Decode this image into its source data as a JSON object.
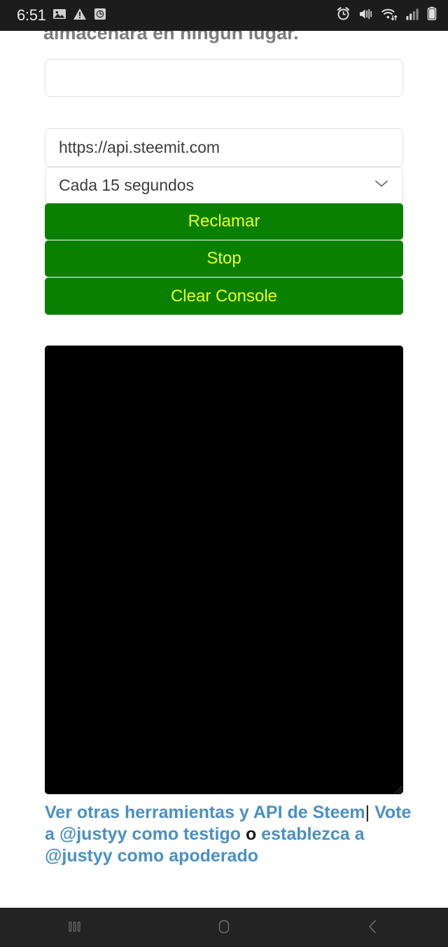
{
  "status_bar": {
    "time": "6:51",
    "left_icons": [
      {
        "name": "image-icon"
      },
      {
        "name": "warning-triangle-icon"
      },
      {
        "name": "timer-icon"
      }
    ],
    "right_icons": [
      {
        "name": "alarm-clock-icon"
      },
      {
        "name": "volume-mute-vibrate-icon"
      },
      {
        "name": "wifi-data-transfer-icon"
      },
      {
        "name": "cellular-signal-icon"
      },
      {
        "name": "battery-icon"
      }
    ],
    "background_color": "#1c1c1c",
    "foreground_color": "#e8e8e8"
  },
  "page": {
    "intro_text": "almacenará en ningún lugar.",
    "key_input": {
      "value": "",
      "placeholder": ""
    },
    "api_input": {
      "value": "https://api.steemit.com",
      "placeholder": "https://api.steemit.com"
    },
    "interval_select": {
      "selected": "Cada 15 segundos",
      "icon": "chevron-down-icon",
      "options": [
        "Cada 15 segundos"
      ]
    },
    "buttons": {
      "claim_label": "Reclamar",
      "stop_label": "Stop",
      "clear_console_label": "Clear Console",
      "background_color": "#0a8000",
      "text_color": "#e8ff1a"
    },
    "console": {
      "value": "",
      "background_color": "#000000"
    },
    "footer": {
      "link_1": "Ver otras herramientas y API de Steem",
      "separator_1": "|",
      "link_2": "Vote a @justyy como testigo",
      "separator_2": "o",
      "link_3": "establezca a @justyy como apoderado",
      "link_color": "#4a90c4"
    }
  },
  "nav_bar": {
    "buttons": [
      {
        "name": "recents-button",
        "icon": "recents-icon"
      },
      {
        "name": "home-button",
        "icon": "home-icon"
      },
      {
        "name": "back-button",
        "icon": "chevron-left-icon"
      }
    ],
    "background_color": "#232323"
  }
}
